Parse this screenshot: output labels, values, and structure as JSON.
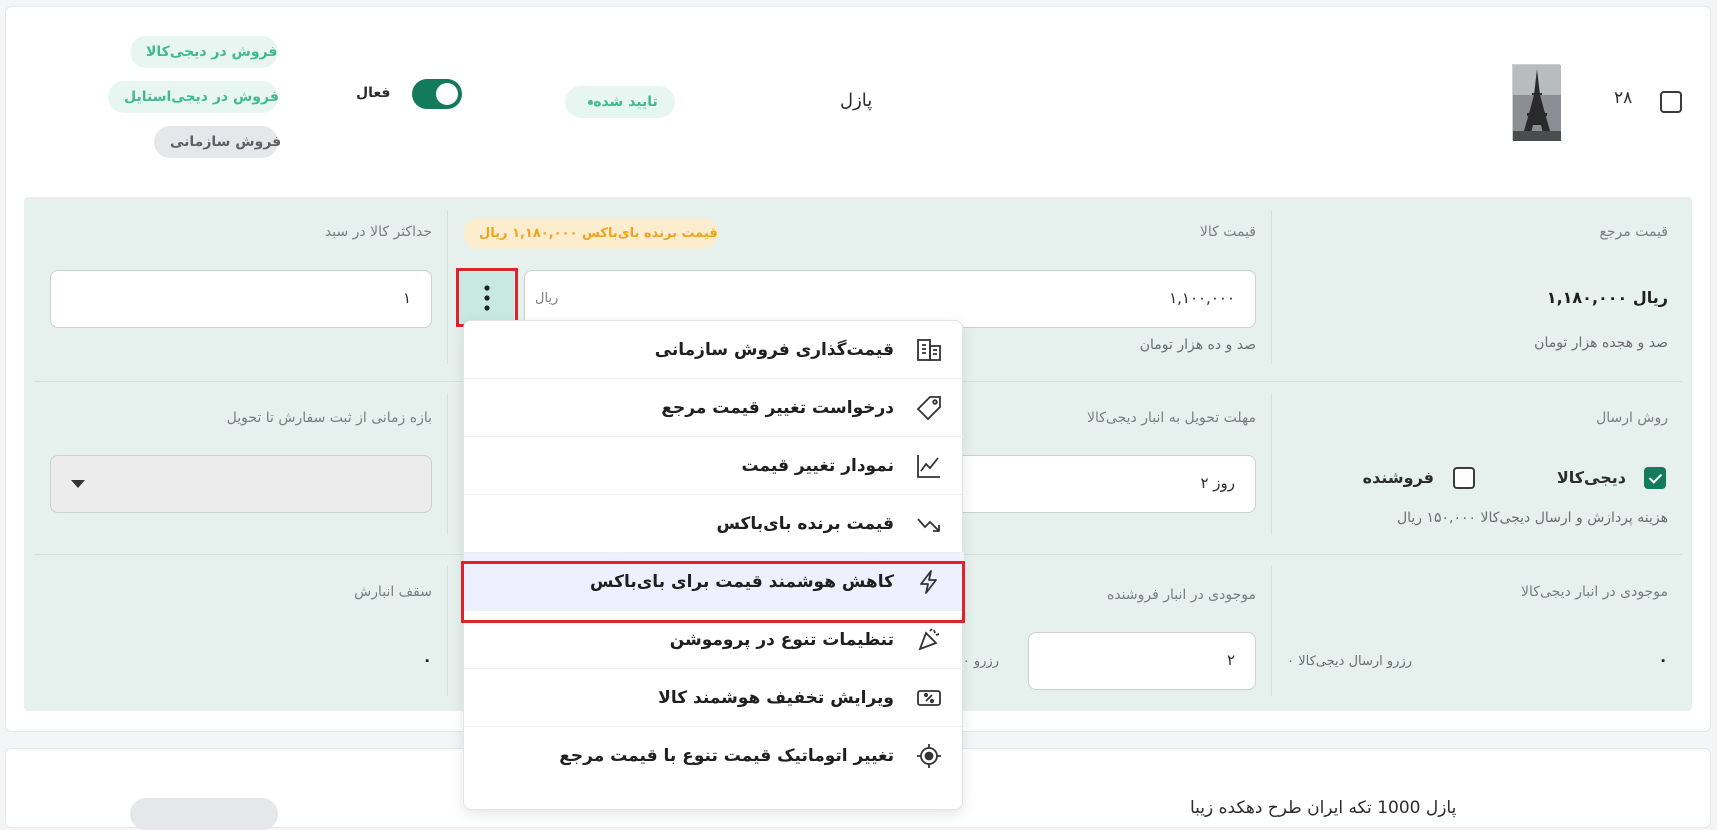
{
  "product_row": {
    "index": "۲۸",
    "title": "پازل",
    "status": "تایید شده",
    "active_label": "فعال",
    "active_on": true,
    "channels": [
      "فروش در دیجی‌کالا",
      "فروش در دیجی‌استایل",
      "فروش سازمانی"
    ]
  },
  "pricing": {
    "ref_price_label": "قیمت مرجع",
    "ref_price_value": "۱,۱۸۰,۰۰۰ ریال",
    "ref_price_words": "صد و هجده هزار تومان",
    "price_label": "قیمت کالا",
    "price_value": "۱,۱۰۰,۰۰۰",
    "price_unit": "ریال",
    "price_words": "صد و ده هزار تومان",
    "buybox_badge": "قیمت برنده بای‌باکس ۱,۱۸۰,۰۰۰ ریال",
    "max_cart_label": "حداکثر کالا در سبد",
    "max_cart_value": "۱"
  },
  "shipping": {
    "method_label": "روش ارسال",
    "option_digikala": "دیجی‌کالا",
    "option_seller": "فروشنده",
    "digikala_checked": true,
    "seller_checked": false,
    "fee_note": "هزینه پردازش و ارسال دیجی‌کالا ۱۵۰,۰۰۰ ریال",
    "lead_label": "مهلت تحویل به انبار دیجی‌کالا",
    "lead_value": "۲ روز",
    "window_label": "بازه زمانی از ثبت سفارش تا تحویل"
  },
  "stock": {
    "dk_label": "موجودی در انبار دیجی‌کالا",
    "dk_value": "۰",
    "dk_reserve": "۰ رزرو ارسال دیجی‌کالا",
    "seller_label": "موجودی در انبار فروشنده",
    "seller_value": "۲",
    "seller_reserve": "۰ رزرو",
    "cap_label": "سقف انبارش",
    "cap_value": "۰"
  },
  "menu": {
    "items": [
      {
        "label": "قیمت‌گذاری فروش سازمانی",
        "icon": "building-icon"
      },
      {
        "label": "درخواست تغییر قیمت مرجع",
        "icon": "tag-icon"
      },
      {
        "label": "نمودار تغییر قیمت",
        "icon": "line-chart-icon"
      },
      {
        "label": "قیمت برنده بای‌باکس",
        "icon": "trend-down-icon"
      },
      {
        "label": "کاهش هوشمند قیمت برای بای‌باکس",
        "icon": "lightning-icon"
      },
      {
        "label": "تنظیمات تنوع در پروموشن",
        "icon": "promotion-icon"
      },
      {
        "label": "ویرایش تخفیف هوشمند کالا",
        "icon": "discount-ticket-icon"
      },
      {
        "label": "تغییر اتوماتیک قیمت تنوع با قیمت مرجع",
        "icon": "target-icon"
      }
    ]
  },
  "next_row": {
    "title_partial": "پازل 1000 تکه ایران طرح دهکده زیبا"
  }
}
